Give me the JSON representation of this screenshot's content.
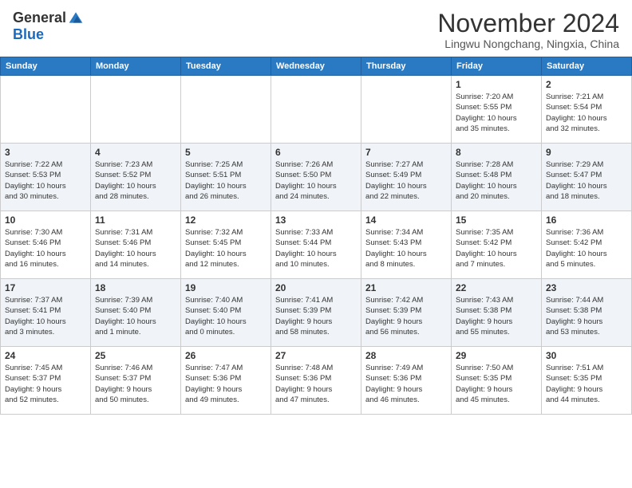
{
  "header": {
    "logo_general": "General",
    "logo_blue": "Blue",
    "month": "November 2024",
    "location": "Lingwu Nongchang, Ningxia, China"
  },
  "days_of_week": [
    "Sunday",
    "Monday",
    "Tuesday",
    "Wednesday",
    "Thursday",
    "Friday",
    "Saturday"
  ],
  "weeks": [
    [
      {
        "day": "",
        "info": ""
      },
      {
        "day": "",
        "info": ""
      },
      {
        "day": "",
        "info": ""
      },
      {
        "day": "",
        "info": ""
      },
      {
        "day": "",
        "info": ""
      },
      {
        "day": "1",
        "info": "Sunrise: 7:20 AM\nSunset: 5:55 PM\nDaylight: 10 hours\nand 35 minutes."
      },
      {
        "day": "2",
        "info": "Sunrise: 7:21 AM\nSunset: 5:54 PM\nDaylight: 10 hours\nand 32 minutes."
      }
    ],
    [
      {
        "day": "3",
        "info": "Sunrise: 7:22 AM\nSunset: 5:53 PM\nDaylight: 10 hours\nand 30 minutes."
      },
      {
        "day": "4",
        "info": "Sunrise: 7:23 AM\nSunset: 5:52 PM\nDaylight: 10 hours\nand 28 minutes."
      },
      {
        "day": "5",
        "info": "Sunrise: 7:25 AM\nSunset: 5:51 PM\nDaylight: 10 hours\nand 26 minutes."
      },
      {
        "day": "6",
        "info": "Sunrise: 7:26 AM\nSunset: 5:50 PM\nDaylight: 10 hours\nand 24 minutes."
      },
      {
        "day": "7",
        "info": "Sunrise: 7:27 AM\nSunset: 5:49 PM\nDaylight: 10 hours\nand 22 minutes."
      },
      {
        "day": "8",
        "info": "Sunrise: 7:28 AM\nSunset: 5:48 PM\nDaylight: 10 hours\nand 20 minutes."
      },
      {
        "day": "9",
        "info": "Sunrise: 7:29 AM\nSunset: 5:47 PM\nDaylight: 10 hours\nand 18 minutes."
      }
    ],
    [
      {
        "day": "10",
        "info": "Sunrise: 7:30 AM\nSunset: 5:46 PM\nDaylight: 10 hours\nand 16 minutes."
      },
      {
        "day": "11",
        "info": "Sunrise: 7:31 AM\nSunset: 5:46 PM\nDaylight: 10 hours\nand 14 minutes."
      },
      {
        "day": "12",
        "info": "Sunrise: 7:32 AM\nSunset: 5:45 PM\nDaylight: 10 hours\nand 12 minutes."
      },
      {
        "day": "13",
        "info": "Sunrise: 7:33 AM\nSunset: 5:44 PM\nDaylight: 10 hours\nand 10 minutes."
      },
      {
        "day": "14",
        "info": "Sunrise: 7:34 AM\nSunset: 5:43 PM\nDaylight: 10 hours\nand 8 minutes."
      },
      {
        "day": "15",
        "info": "Sunrise: 7:35 AM\nSunset: 5:42 PM\nDaylight: 10 hours\nand 7 minutes."
      },
      {
        "day": "16",
        "info": "Sunrise: 7:36 AM\nSunset: 5:42 PM\nDaylight: 10 hours\nand 5 minutes."
      }
    ],
    [
      {
        "day": "17",
        "info": "Sunrise: 7:37 AM\nSunset: 5:41 PM\nDaylight: 10 hours\nand 3 minutes."
      },
      {
        "day": "18",
        "info": "Sunrise: 7:39 AM\nSunset: 5:40 PM\nDaylight: 10 hours\nand 1 minute."
      },
      {
        "day": "19",
        "info": "Sunrise: 7:40 AM\nSunset: 5:40 PM\nDaylight: 10 hours\nand 0 minutes."
      },
      {
        "day": "20",
        "info": "Sunrise: 7:41 AM\nSunset: 5:39 PM\nDaylight: 9 hours\nand 58 minutes."
      },
      {
        "day": "21",
        "info": "Sunrise: 7:42 AM\nSunset: 5:39 PM\nDaylight: 9 hours\nand 56 minutes."
      },
      {
        "day": "22",
        "info": "Sunrise: 7:43 AM\nSunset: 5:38 PM\nDaylight: 9 hours\nand 55 minutes."
      },
      {
        "day": "23",
        "info": "Sunrise: 7:44 AM\nSunset: 5:38 PM\nDaylight: 9 hours\nand 53 minutes."
      }
    ],
    [
      {
        "day": "24",
        "info": "Sunrise: 7:45 AM\nSunset: 5:37 PM\nDaylight: 9 hours\nand 52 minutes."
      },
      {
        "day": "25",
        "info": "Sunrise: 7:46 AM\nSunset: 5:37 PM\nDaylight: 9 hours\nand 50 minutes."
      },
      {
        "day": "26",
        "info": "Sunrise: 7:47 AM\nSunset: 5:36 PM\nDaylight: 9 hours\nand 49 minutes."
      },
      {
        "day": "27",
        "info": "Sunrise: 7:48 AM\nSunset: 5:36 PM\nDaylight: 9 hours\nand 47 minutes."
      },
      {
        "day": "28",
        "info": "Sunrise: 7:49 AM\nSunset: 5:36 PM\nDaylight: 9 hours\nand 46 minutes."
      },
      {
        "day": "29",
        "info": "Sunrise: 7:50 AM\nSunset: 5:35 PM\nDaylight: 9 hours\nand 45 minutes."
      },
      {
        "day": "30",
        "info": "Sunrise: 7:51 AM\nSunset: 5:35 PM\nDaylight: 9 hours\nand 44 minutes."
      }
    ]
  ]
}
